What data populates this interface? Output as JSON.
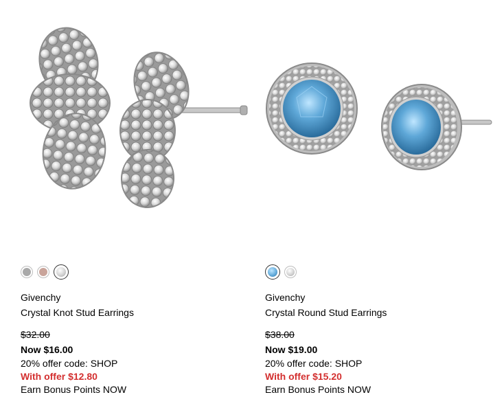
{
  "products": [
    {
      "brand": "Givenchy",
      "name": "Crystal Knot Stud Earrings",
      "original_price": "$32.00",
      "now_price": "Now $16.00",
      "offer_code": "20% offer code: SHOP",
      "offer_price": "With offer $12.80",
      "bonus": "Earn Bonus Points NOW",
      "swatches": [
        {
          "color": "#a9a9a9",
          "selected": false
        },
        {
          "color": "#c9a49a",
          "selected": false
        },
        {
          "color": "#e6e6e6",
          "selected": true
        }
      ]
    },
    {
      "brand": "Givenchy",
      "name": "Crystal Round Stud Earrings",
      "original_price": "$38.00",
      "now_price": "Now $19.00",
      "offer_code": "20% offer code: SHOP",
      "offer_price": "With offer $15.20",
      "bonus": "Earn Bonus Points NOW",
      "swatches": [
        {
          "color": "#5fa8d8",
          "selected": true
        },
        {
          "color": "#cfcfcf",
          "selected": false
        }
      ]
    }
  ],
  "colors": {
    "offer_red": "#d32f2f",
    "crystal_blue": "#5fa8d8",
    "silver": "#c8c8c8"
  }
}
